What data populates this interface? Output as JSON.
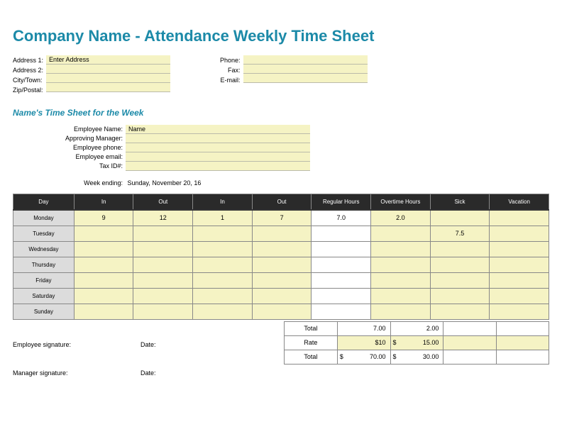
{
  "title": "Company Name - Attendance Weekly Time Sheet",
  "company": {
    "labels": {
      "addr1": "Address 1:",
      "addr2": "Address 2:",
      "city": "City/Town:",
      "zip": "Zip/Postal:",
      "phone": "Phone:",
      "fax": "Fax:",
      "email": "E-mail:"
    },
    "values": {
      "addr1": "Enter Address",
      "addr2": "",
      "city": "",
      "zip": "",
      "phone": "",
      "fax": "",
      "email": ""
    }
  },
  "subheading": "Name's Time Sheet for the Week",
  "employee": {
    "labels": {
      "name": "Employee Name:",
      "manager": "Approving Manager:",
      "phone": "Employee phone:",
      "email": "Employee email:",
      "tax": "Tax ID#:"
    },
    "values": {
      "name": "Name",
      "manager": "",
      "phone": "",
      "email": "",
      "tax": ""
    }
  },
  "week_ending": {
    "label": "Week ending:",
    "value": "Sunday, November 20, 16"
  },
  "headers": [
    "Day",
    "In",
    "Out",
    "In",
    "Out",
    "Regular Hours",
    "Overtime Hours",
    "Sick",
    "Vacation"
  ],
  "days": [
    "Monday",
    "Tuesday",
    "Wednesday",
    "Thursday",
    "Friday",
    "Saturday",
    "Sunday"
  ],
  "rows": [
    {
      "in1": "9",
      "out1": "12",
      "in2": "1",
      "out2": "7",
      "reg": "7.0",
      "ot": "2.0",
      "sick": "",
      "vac": ""
    },
    {
      "in1": "",
      "out1": "",
      "in2": "",
      "out2": "",
      "reg": "",
      "ot": "",
      "sick": "7.5",
      "vac": ""
    },
    {
      "in1": "",
      "out1": "",
      "in2": "",
      "out2": "",
      "reg": "",
      "ot": "",
      "sick": "",
      "vac": ""
    },
    {
      "in1": "",
      "out1": "",
      "in2": "",
      "out2": "",
      "reg": "",
      "ot": "",
      "sick": "",
      "vac": ""
    },
    {
      "in1": "",
      "out1": "",
      "in2": "",
      "out2": "",
      "reg": "",
      "ot": "",
      "sick": "",
      "vac": ""
    },
    {
      "in1": "",
      "out1": "",
      "in2": "",
      "out2": "",
      "reg": "",
      "ot": "",
      "sick": "",
      "vac": ""
    },
    {
      "in1": "",
      "out1": "",
      "in2": "",
      "out2": "",
      "reg": "",
      "ot": "",
      "sick": "",
      "vac": ""
    }
  ],
  "totals": {
    "labels": {
      "total": "Total",
      "rate": "Rate"
    },
    "reg_hours": "7.00",
    "ot_hours": "2.00",
    "reg_rate": "$10",
    "ot_rate_cur": "$",
    "ot_rate": "15.00",
    "reg_total_cur": "$",
    "reg_total": "70.00",
    "ot_total_cur": "$",
    "ot_total": "30.00"
  },
  "signatures": {
    "emp": "Employee signature:",
    "mgr": "Manager signature:",
    "date": "Date:"
  }
}
